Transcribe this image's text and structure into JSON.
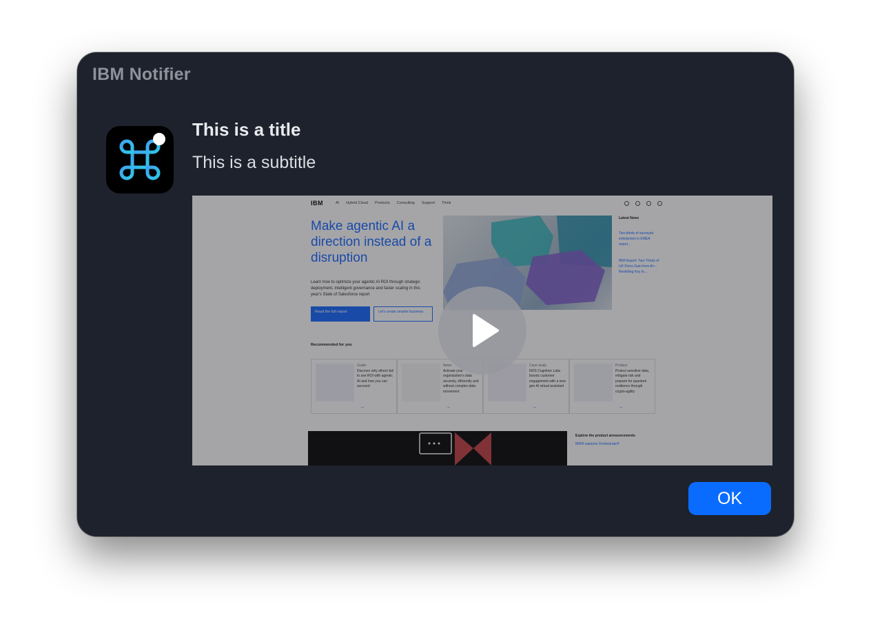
{
  "window": {
    "app_name": "IBM Notifier"
  },
  "notification": {
    "icon": "command-key-icon",
    "title": "This is a title",
    "subtitle": "This is a subtitle"
  },
  "media": {
    "type": "video",
    "play_icon": "play-icon",
    "preview": {
      "logo": "IBM",
      "nav": [
        "AI",
        "Hybrid Cloud",
        "Products",
        "Consulting",
        "Support",
        "Think"
      ],
      "hero_heading": "Make agentic AI a direction instead of a disruption",
      "hero_text": "Learn how to optimize your agentic AI ROI through strategic deployment, intelligent governance and faster scaling in this year's State of Salesforce report",
      "primary_cta": "Read the full report",
      "secondary_cta": "Let's create smarter business",
      "news_heading": "Latest News",
      "news": [
        "Two-thirds of surveyed enterprises in EMEA report...",
        "IBM Report: Two-Thirds of UK Firms Gain from AI—Reskilling Key to..."
      ],
      "recommended_heading": "Recommended for you",
      "cards": [
        {
          "tag": "Guide",
          "text": "Discover why others fail to see ROI with agentic AI and how you can succeed"
        },
        {
          "tag": "News",
          "text": "Activate your organization's data securely, efficiently and without complex data movement"
        },
        {
          "tag": "Case study",
          "text": "NOS Cognitive Labs boosts customer engagement with a new gen AI virtual assistant"
        },
        {
          "tag": "Product",
          "text": "Protect sensitive data, mitigate risk and prepare for quantum resilience through crypto-agility"
        }
      ],
      "announcements_heading": "Explore the product announcements",
      "announcement_link": "IBM® watsonx Orchestrate®"
    }
  },
  "actions": {
    "ok_label": "OK"
  },
  "colors": {
    "window_bg": "#1e222d",
    "accent": "#0a6cff"
  }
}
